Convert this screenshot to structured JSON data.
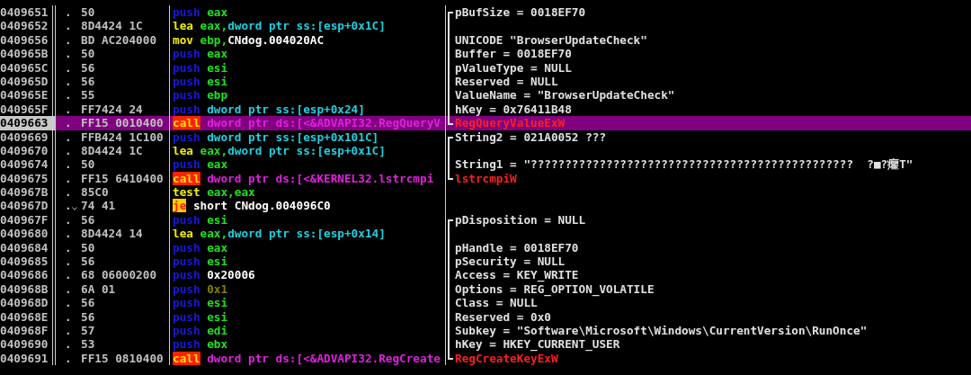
{
  "rows": [
    {
      "address": "0409651",
      "marker": ".",
      "jumps": false,
      "hex": "50",
      "selected": false,
      "instruction": {
        "mnemonic": "push",
        "kind": "push",
        "operands": [
          {
            "text": "eax",
            "kind": "register"
          }
        ]
      },
      "kind": "group_start",
      "comment": {
        "text": "pBufSize = 0018EF70",
        "kind": "argument"
      }
    },
    {
      "address": "0409652",
      "marker": ".",
      "jumps": false,
      "hex": "8D4424 1C",
      "selected": false,
      "instruction": {
        "mnemonic": "lea",
        "kind": "plain",
        "operands": [
          {
            "text": "eax,",
            "kind": "register"
          },
          {
            "text": "dword ptr ss:[esp+0x1C]",
            "kind": "memory"
          }
        ]
      },
      "kind": "group_middle"
    },
    {
      "address": "0409656",
      "marker": ".",
      "jumps": false,
      "hex": "BD AC204000",
      "selected": false,
      "instruction": {
        "mnemonic": "mov",
        "kind": "plain",
        "operands": [
          {
            "text": "ebp,",
            "kind": "register"
          },
          {
            "text": "CNdog.004020AC",
            "kind": "value"
          }
        ]
      },
      "kind": "group_middle",
      "comment": {
        "text": "UNICODE \"BrowserUpdateCheck\"",
        "kind": "argument"
      }
    },
    {
      "address": "040965B",
      "marker": ".",
      "jumps": false,
      "hex": "50",
      "selected": false,
      "instruction": {
        "mnemonic": "push",
        "kind": "push",
        "operands": [
          {
            "text": "eax",
            "kind": "register"
          }
        ]
      },
      "kind": "group_middle",
      "comment": {
        "text": "Buffer = 0018EF70",
        "kind": "argument"
      }
    },
    {
      "address": "040965C",
      "marker": ".",
      "jumps": false,
      "hex": "56",
      "selected": false,
      "instruction": {
        "mnemonic": "push",
        "kind": "push",
        "operands": [
          {
            "text": "esi",
            "kind": "register"
          }
        ]
      },
      "kind": "group_middle",
      "comment": {
        "text": "pValueType = NULL",
        "kind": "argument"
      }
    },
    {
      "address": "040965D",
      "marker": ".",
      "jumps": false,
      "hex": "56",
      "selected": false,
      "instruction": {
        "mnemonic": "push",
        "kind": "push",
        "operands": [
          {
            "text": "esi",
            "kind": "register"
          }
        ]
      },
      "kind": "group_middle",
      "comment": {
        "text": "Reserved = NULL",
        "kind": "argument"
      }
    },
    {
      "address": "040965E",
      "marker": ".",
      "jumps": false,
      "hex": "55",
      "selected": false,
      "instruction": {
        "mnemonic": "push",
        "kind": "push",
        "operands": [
          {
            "text": "ebp",
            "kind": "register"
          }
        ]
      },
      "kind": "group_middle",
      "comment": {
        "text": "ValueName = \"BrowserUpdateCheck\"",
        "kind": "argument"
      }
    },
    {
      "address": "040965F",
      "marker": ".",
      "jumps": false,
      "hex": "FF7424 24",
      "selected": false,
      "instruction": {
        "mnemonic": "push",
        "kind": "push",
        "operands": [
          {
            "text": "dword ptr ss:[esp+0x24]",
            "kind": "memory"
          }
        ]
      },
      "kind": "group_middle",
      "comment": {
        "text": "hKey = 0x76411B48",
        "kind": "argument"
      }
    },
    {
      "address": "0409663",
      "marker": ".",
      "jumps": false,
      "hex": "FF15 0010400",
      "selected": true,
      "instruction": {
        "mnemonic": "call",
        "kind": "call",
        "operands": [
          {
            "text": "dword ptr ds:[<&ADVAPI32.RegQueryV",
            "kind": "api"
          }
        ]
      },
      "kind": "group_end",
      "comment": {
        "text": "RegQueryValueExW",
        "kind": "function"
      }
    },
    {
      "address": "0409669",
      "marker": ".",
      "jumps": false,
      "hex": "FFB424 1C100",
      "selected": false,
      "instruction": {
        "mnemonic": "push",
        "kind": "push",
        "operands": [
          {
            "text": "dword ptr ss:[esp+0x101C]",
            "kind": "memory"
          }
        ]
      },
      "kind": "group_start",
      "comment": {
        "text": "String2 = 021A0052 ???",
        "kind": "argument"
      }
    },
    {
      "address": "0409670",
      "marker": ".",
      "jumps": false,
      "hex": "8D4424 1C",
      "selected": false,
      "instruction": {
        "mnemonic": "lea",
        "kind": "plain",
        "operands": [
          {
            "text": "eax,",
            "kind": "register"
          },
          {
            "text": "dword ptr ss:[esp+0x1C]",
            "kind": "memory"
          }
        ]
      },
      "kind": "group_middle"
    },
    {
      "address": "0409674",
      "marker": ".",
      "jumps": false,
      "hex": "50",
      "selected": false,
      "instruction": {
        "mnemonic": "push",
        "kind": "push",
        "operands": [
          {
            "text": "eax",
            "kind": "register"
          }
        ]
      },
      "kind": "group_middle",
      "comment": {
        "text": "String1 = \"???????????????????????????????????????????????  ?■?癯T\"",
        "kind": "argument"
      }
    },
    {
      "address": "0409675",
      "marker": ".",
      "jumps": false,
      "hex": "FF15 6410400",
      "selected": false,
      "instruction": {
        "mnemonic": "call",
        "kind": "call",
        "operands": [
          {
            "text": "dword ptr ds:[<&KERNEL32.lstrcmpi",
            "kind": "api"
          }
        ]
      },
      "kind": "group_end",
      "comment": {
        "text": "lstrcmpiW",
        "kind": "function"
      }
    },
    {
      "address": "040967B",
      "marker": ".",
      "jumps": false,
      "hex": "85C0",
      "selected": false,
      "instruction": {
        "mnemonic": "test",
        "kind": "plain",
        "operands": [
          {
            "text": "eax,eax",
            "kind": "register"
          }
        ]
      },
      "kind": "plain"
    },
    {
      "address": "040967D",
      "marker": ".",
      "jumps": true,
      "hex": "74 41",
      "selected": false,
      "instruction": {
        "mnemonic": "je",
        "kind": "jump",
        "operands": [
          {
            "text": "short CNdog.004096C0",
            "kind": "value"
          }
        ]
      },
      "kind": "plain"
    },
    {
      "address": "040967F",
      "marker": ".",
      "jumps": false,
      "hex": "56",
      "selected": false,
      "instruction": {
        "mnemonic": "push",
        "kind": "push",
        "operands": [
          {
            "text": "esi",
            "kind": "register"
          }
        ]
      },
      "kind": "group_start",
      "comment": {
        "text": "pDisposition = NULL",
        "kind": "argument"
      }
    },
    {
      "address": "0409680",
      "marker": ".",
      "jumps": false,
      "hex": "8D4424 14",
      "selected": false,
      "instruction": {
        "mnemonic": "lea",
        "kind": "plain",
        "operands": [
          {
            "text": "eax,",
            "kind": "register"
          },
          {
            "text": "dword ptr ss:[esp+0x14]",
            "kind": "memory"
          }
        ]
      },
      "kind": "group_middle"
    },
    {
      "address": "0409684",
      "marker": ".",
      "jumps": false,
      "hex": "50",
      "selected": false,
      "instruction": {
        "mnemonic": "push",
        "kind": "push",
        "operands": [
          {
            "text": "eax",
            "kind": "register"
          }
        ]
      },
      "kind": "group_middle",
      "comment": {
        "text": "pHandle = 0018EF70",
        "kind": "argument"
      }
    },
    {
      "address": "0409685",
      "marker": ".",
      "jumps": false,
      "hex": "56",
      "selected": false,
      "instruction": {
        "mnemonic": "push",
        "kind": "push",
        "operands": [
          {
            "text": "esi",
            "kind": "register"
          }
        ]
      },
      "kind": "group_middle",
      "comment": {
        "text": "pSecurity = NULL",
        "kind": "argument"
      }
    },
    {
      "address": "0409686",
      "marker": ".",
      "jumps": false,
      "hex": "68 06000200",
      "selected": false,
      "instruction": {
        "mnemonic": "push",
        "kind": "push",
        "operands": [
          {
            "text": "0x20006",
            "kind": "value"
          }
        ]
      },
      "kind": "group_middle",
      "comment": {
        "text": "Access = KEY_WRITE",
        "kind": "argument"
      }
    },
    {
      "address": "040968B",
      "marker": ".",
      "jumps": false,
      "hex": "6A 01",
      "selected": false,
      "instruction": {
        "mnemonic": "push",
        "kind": "push",
        "operands": [
          {
            "text": "0x1",
            "kind": "constant"
          }
        ]
      },
      "kind": "group_middle",
      "comment": {
        "text": "Options = REG_OPTION_VOLATILE",
        "kind": "argument"
      }
    },
    {
      "address": "040968D",
      "marker": ".",
      "jumps": false,
      "hex": "56",
      "selected": false,
      "instruction": {
        "mnemonic": "push",
        "kind": "push",
        "operands": [
          {
            "text": "esi",
            "kind": "register"
          }
        ]
      },
      "kind": "group_middle",
      "comment": {
        "text": "Class = NULL",
        "kind": "argument"
      }
    },
    {
      "address": "040968E",
      "marker": ".",
      "jumps": false,
      "hex": "56",
      "selected": false,
      "instruction": {
        "mnemonic": "push",
        "kind": "push",
        "operands": [
          {
            "text": "esi",
            "kind": "register"
          }
        ]
      },
      "kind": "group_middle",
      "comment": {
        "text": "Reserved = 0x0",
        "kind": "argument"
      }
    },
    {
      "address": "040968F",
      "marker": ".",
      "jumps": false,
      "hex": "57",
      "selected": false,
      "instruction": {
        "mnemonic": "push",
        "kind": "push",
        "operands": [
          {
            "text": "edi",
            "kind": "register"
          }
        ]
      },
      "kind": "group_middle",
      "comment": {
        "text": "Subkey = \"Software\\Microsoft\\Windows\\CurrentVersion\\RunOnce\"",
        "kind": "argument"
      }
    },
    {
      "address": "0409690",
      "marker": ".",
      "jumps": false,
      "hex": "53",
      "selected": false,
      "instruction": {
        "mnemonic": "push",
        "kind": "push",
        "operands": [
          {
            "text": "ebx",
            "kind": "register"
          }
        ]
      },
      "kind": "group_middle",
      "comment": {
        "text": "hKey = HKEY_CURRENT_USER",
        "kind": "argument"
      }
    },
    {
      "address": "0409691",
      "marker": ".",
      "jumps": false,
      "hex": "FF15 0810400",
      "selected": false,
      "instruction": {
        "mnemonic": "call",
        "kind": "call",
        "operands": [
          {
            "text": "dword ptr ds:[<&ADVAPI32.RegCreate",
            "kind": "api"
          }
        ]
      },
      "kind": "group_end",
      "comment": {
        "text": "RegCreateKeyExW",
        "kind": "function"
      }
    }
  ]
}
